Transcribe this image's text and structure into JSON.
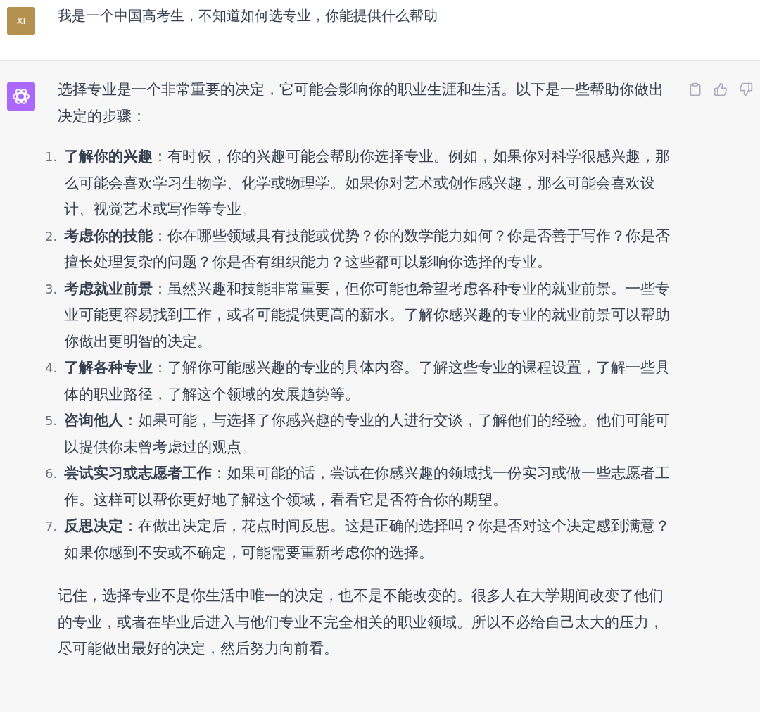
{
  "user_message": {
    "avatar": "XI",
    "text": "我是一个中国高考生，不知道如何选专业，你能提供什么帮助"
  },
  "assistant_message": {
    "intro": "选择专业是一个非常重要的决定，它可能会影响你的职业生涯和生活。以下是一些帮助你做出决定的步骤：",
    "steps": [
      {
        "number": "1.",
        "text": "**了解你的兴趣**：有时候，你的兴趣可能会帮助你选择专业。例如，如果你对科学很感兴趣，那么可能会喜欢学习生物学、化学或物理学。如果你对艺术或创作感兴趣，那么可能会喜欢设计、视觉艺术或写作等专业。"
      },
      {
        "number": "2.",
        "text": "**考虑你的技能**：你在哪些领域具有技能或优势？你的数学能力如何？你是否善于写作？你是否擅长处理复杂的问题？你是否有组织能力？这些都可以影响你选择的专业。"
      },
      {
        "number": "3.",
        "text": "**考虑就业前景**：虽然兴趣和技能非常重要，但你可能也希望考虑各种专业的就业前景。一些专业可能更容易找到工作，或者可能提供更高的薪水。了解你感兴趣的专业的就业前景可以帮助你做出更明智的决定。"
      },
      {
        "number": "4.",
        "text": "**了解各种专业**：了解你可能感兴趣的专业的具体内容。了解这些专业的课程设置，了解一些具体的职业路径，了解这个领域的发展趋势等。"
      },
      {
        "number": "5.",
        "text": "**咨询他人**：如果可能，与选择了你感兴趣的专业的人进行交谈，了解他们的经验。他们可能可以提供你未曾考虑过的观点。"
      },
      {
        "number": "6.",
        "text": "**尝试实习或志愿者工作**：如果可能的话，尝试在你感兴趣的领域找一份实习或做一些志愿者工作。这样可以帮你更好地了解这个领域，看看它是否符合你的期望。"
      },
      {
        "number": "7.",
        "text": "**反思决定**：在做出决定后，花点时间反思。这是正确的选择吗？你是否对这个决定感到满意？如果你感到不安或不确定，可能需要重新考虑你的选择。"
      }
    ],
    "closing": "记住，选择专业不是你生活中唯一的决定，也不是不能改变的。很多人在大学期间改变了他们的专业，或者在毕业后进入与他们专业不完全相关的职业领域。所以不必给自己太大的压力，尽可能做出最好的决定，然后努力向前看。"
  }
}
